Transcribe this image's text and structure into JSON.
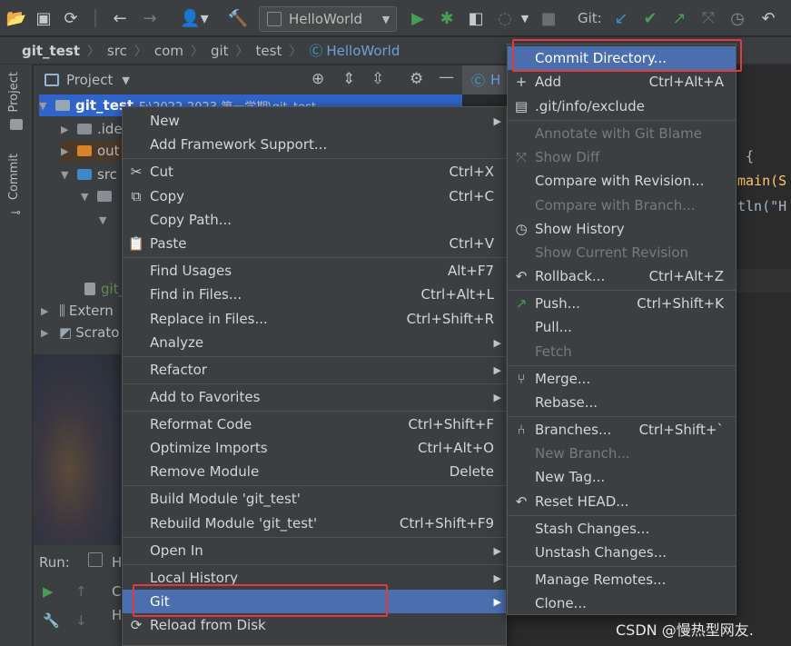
{
  "toolbar": {
    "run_config": "HelloWorld",
    "git_label": "Git:"
  },
  "breadcrumb": [
    "git_test",
    "src",
    "com",
    "git",
    "test",
    "HelloWorld"
  ],
  "sidebar": {
    "project_tab": "Project",
    "commit_tab": "Commit"
  },
  "project_panel": {
    "title": "Project",
    "tree": [
      {
        "label": "git_test",
        "path": "F:\\2022-2023 第一学期\\git_test"
      },
      {
        "label": ".ide"
      },
      {
        "label": "out"
      },
      {
        "label": "src"
      },
      {
        "label": "git_"
      },
      {
        "label": "Extern"
      },
      {
        "label": "Scrato"
      }
    ]
  },
  "editor": {
    "tab": "H",
    "lines": [
      "{",
      "main(S",
      "tln(\"H"
    ]
  },
  "run": {
    "label": "Run:",
    "tab": "H",
    "out1": "C",
    "out2": "H"
  },
  "context_menu": {
    "items": [
      {
        "label": "New",
        "submenu": true
      },
      {
        "label": "Add Framework Support..."
      },
      {
        "label": "Cut",
        "shortcut": "Ctrl+X",
        "icon": "scissors-icon"
      },
      {
        "label": "Copy",
        "shortcut": "Ctrl+C",
        "icon": "copy-icon"
      },
      {
        "label": "Copy Path..."
      },
      {
        "label": "Paste",
        "shortcut": "Ctrl+V",
        "icon": "paste-icon"
      },
      {
        "label": "Find Usages",
        "shortcut": "Alt+F7"
      },
      {
        "label": "Find in Files...",
        "shortcut": "Ctrl+Alt+L"
      },
      {
        "label": "Replace in Files...",
        "shortcut": "Ctrl+Shift+R"
      },
      {
        "label": "Analyze",
        "submenu": true
      },
      {
        "label": "Refactor",
        "submenu": true
      },
      {
        "label": "Add to Favorites",
        "submenu": true
      },
      {
        "label": "Reformat Code",
        "shortcut": "Ctrl+Shift+F"
      },
      {
        "label": "Optimize Imports",
        "shortcut": "Ctrl+Alt+O"
      },
      {
        "label": "Remove Module",
        "shortcut": "Delete"
      },
      {
        "label": "Build Module 'git_test'"
      },
      {
        "label": "Rebuild Module 'git_test'",
        "shortcut": "Ctrl+Shift+F9"
      },
      {
        "label": "Open In",
        "submenu": true
      },
      {
        "label": "Local History",
        "submenu": true
      },
      {
        "label": "Git",
        "submenu": true,
        "selected": true
      },
      {
        "label": "Reload from Disk",
        "icon": "reload-icon"
      }
    ]
  },
  "git_menu": {
    "items": [
      {
        "label": "Commit Directory...",
        "selected": true
      },
      {
        "label": "Add",
        "shortcut": "Ctrl+Alt+A",
        "icon": "plus-icon"
      },
      {
        "label": ".git/info/exclude",
        "icon": "file-icon"
      },
      {
        "label": "Annotate with Git Blame",
        "disabled": true
      },
      {
        "label": "Show Diff",
        "disabled": true,
        "icon": "diff-icon"
      },
      {
        "label": "Compare with Revision..."
      },
      {
        "label": "Compare with Branch...",
        "disabled": true
      },
      {
        "label": "Show History",
        "icon": "clock-icon"
      },
      {
        "label": "Show Current Revision",
        "disabled": true
      },
      {
        "label": "Rollback...",
        "shortcut": "Ctrl+Alt+Z",
        "icon": "undo-icon"
      },
      {
        "label": "Push...",
        "shortcut": "Ctrl+Shift+K",
        "icon": "push-arrow-icon"
      },
      {
        "label": "Pull..."
      },
      {
        "label": "Fetch",
        "disabled": true
      },
      {
        "label": "Merge...",
        "icon": "merge-icon"
      },
      {
        "label": "Rebase..."
      },
      {
        "label": "Branches...",
        "shortcut": "Ctrl+Shift+`",
        "icon": "branch-icon"
      },
      {
        "label": "New Branch...",
        "disabled": true
      },
      {
        "label": "New Tag..."
      },
      {
        "label": "Reset HEAD...",
        "icon": "undo-icon"
      },
      {
        "label": "Stash Changes..."
      },
      {
        "label": "Unstash Changes..."
      },
      {
        "label": "Manage Remotes..."
      },
      {
        "label": "Clone..."
      }
    ]
  },
  "watermark": "CSDN @慢热型网友.",
  "colors": {
    "accent": "#4b6eaf",
    "highlight_box": "#e03a3a",
    "run_green": "#499c54"
  }
}
